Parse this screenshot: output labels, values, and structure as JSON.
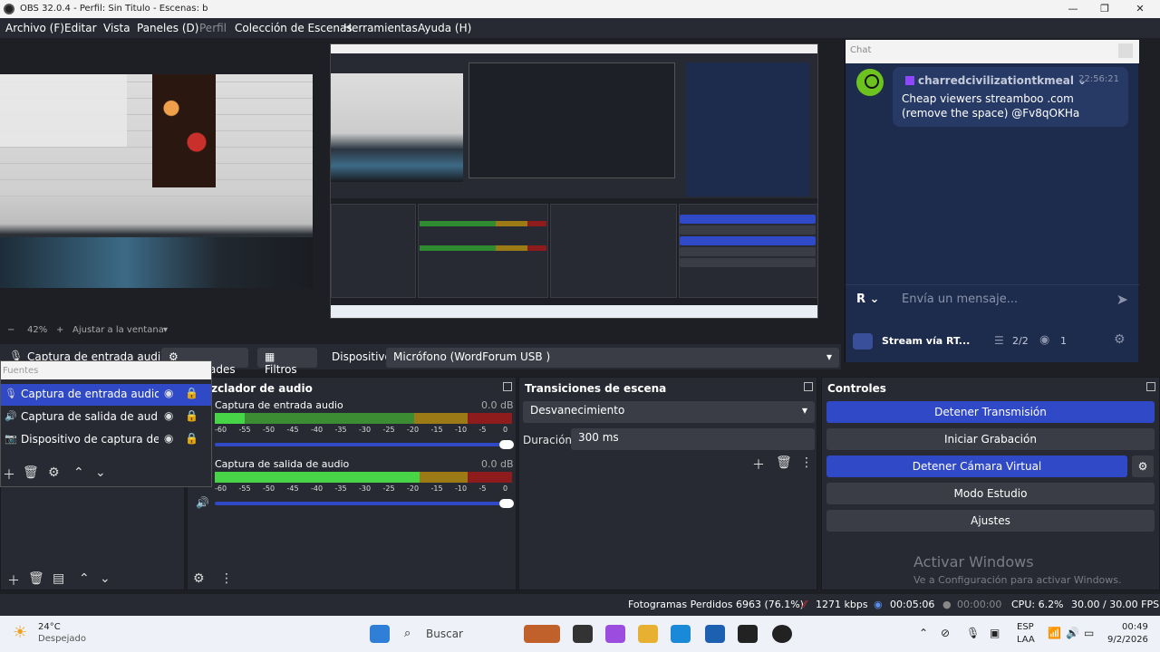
{
  "window": {
    "title": "OBS 32.0.4 - Perfil: Sin Titulo - Escenas: b",
    "minimize": "—",
    "maximize": "❐",
    "close": "✕"
  },
  "menu": [
    {
      "label": "Archivo (F)"
    },
    {
      "label": "Editar"
    },
    {
      "label": "Vista"
    },
    {
      "label": "Paneles (D)"
    },
    {
      "label": "Perfil"
    },
    {
      "label": "Colección de Escenas"
    },
    {
      "label": "Herramientas"
    },
    {
      "label": "Ayuda (H)"
    }
  ],
  "chat": {
    "header": "Chat",
    "username": "charredcivilizationtkmeal",
    "time": "22:56:21",
    "message": "Cheap viewers streamboo .com (remove the space) @Fv8qOKHa",
    "input_placeholder": "Envía un mensaje...",
    "stream_name": "Stream vía RT...",
    "guests": "2/2",
    "viewers": "1"
  },
  "preview_controls": {
    "zoom_minus": "−",
    "zoom": "42%",
    "zoom_plus": "+",
    "fit": "Ajustar a la ventana"
  },
  "source_bar": {
    "selected": "Captura de entrada audio",
    "properties": "Propiedades",
    "filters": "Filtros",
    "device_label": "Dispositivo",
    "device_value": "Micrófono (WordForum USB    )"
  },
  "sources": {
    "title": "Fuentes",
    "items": [
      {
        "label": "Captura de entrada audio"
      },
      {
        "label": "Captura de salida de audio"
      },
      {
        "label": "Dispositivo de captura de video"
      }
    ]
  },
  "mixer": {
    "title": "Mezclador de audio",
    "channels": [
      {
        "name": "Captura de entrada audio",
        "db": "0.0 dB",
        "level": 0.1
      },
      {
        "name": "Captura de salida de audio",
        "db": "0.0 dB",
        "level": 0.69
      }
    ],
    "scale": [
      "-60",
      "-55",
      "-50",
      "-45",
      "-40",
      "-35",
      "-30",
      "-25",
      "-20",
      "-15",
      "-10",
      "-5",
      "0"
    ]
  },
  "transitions": {
    "title": "Transiciones de escena",
    "type": "Desvanecimiento",
    "duration_label": "Duración",
    "duration_value": "300 ms"
  },
  "controls": {
    "title": "Controles",
    "stop_stream": "Detener Transmisión",
    "start_record": "Iniciar Grabación",
    "stop_virtualcam": "Detener Cámara Virtual",
    "studio_mode": "Modo Estudio",
    "settings": "Ajustes"
  },
  "watermark": {
    "line1": "Activar Windows",
    "line2": "Ve a Configuración para activar Windows."
  },
  "status": {
    "dropped": "Fotogramas Perdidos 6963 (76.1%)",
    "bitrate": "1271 kbps",
    "stream_time": "00:05:06",
    "rec_time": "00:00:00",
    "cpu": "CPU: 6.2%",
    "fps": "30.00 / 30.00 FPS"
  },
  "taskbar": {
    "weather_temp": "24°C",
    "weather_desc": "Despejado",
    "search": "Buscar",
    "lang1": "ESP",
    "lang2": "LAA",
    "time": "00:49",
    "date": "9/2/2026"
  },
  "colors": {
    "accent": "#2f49c7",
    "panel": "#272a33",
    "chat_bg": "#1d2b4d"
  }
}
